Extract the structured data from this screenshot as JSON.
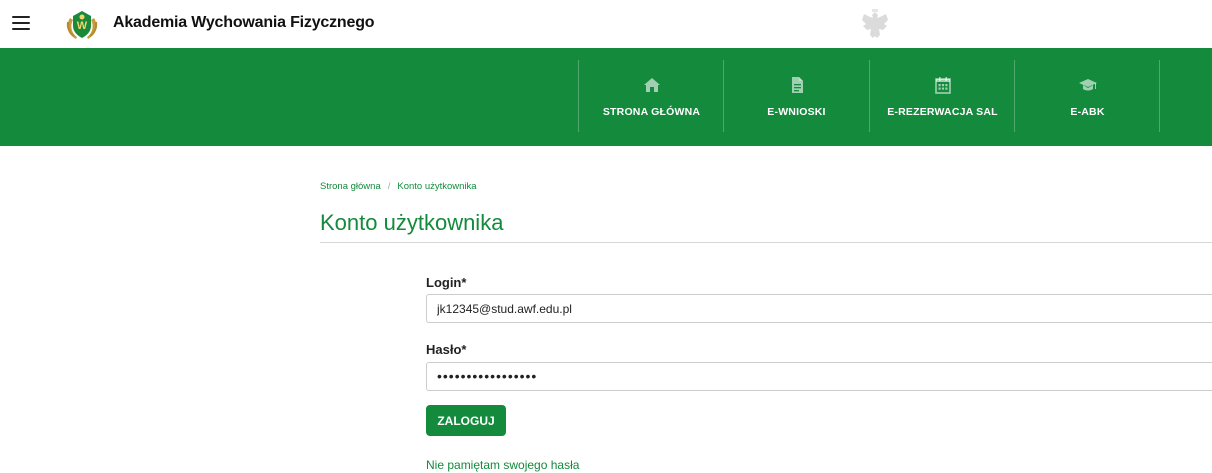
{
  "header": {
    "brand": "Akademia Wychowania Fizycznego",
    "menu_icon": "hamburger-menu-icon",
    "logo_icon": "awf-logo-icon",
    "emblem_icon": "polish-eagle-emblem-icon"
  },
  "nav": {
    "items": [
      {
        "label": "STRONA GŁÓWNA",
        "icon": "home-icon"
      },
      {
        "label": "E-WNIOSKI",
        "icon": "document-icon"
      },
      {
        "label": "E-REZERWACJA SAL",
        "icon": "calendar-icon"
      },
      {
        "label": "E-ABK",
        "icon": "graduation-cap-icon"
      }
    ]
  },
  "breadcrumb": {
    "home": "Strona główna",
    "separator": "/",
    "current": "Konto użytkownika"
  },
  "page": {
    "title": "Konto użytkownika"
  },
  "form": {
    "login_label": "Login*",
    "login_value": "jk12345@stud.awf.edu.pl",
    "password_label": "Hasło*",
    "password_value": "•••••••••••••••••",
    "submit_label": "ZALOGUJ",
    "forgot_link": "Nie pamiętam swojego hasła"
  },
  "colors": {
    "primary": "#138a3c",
    "text": "#222222",
    "border": "#cccccc"
  }
}
